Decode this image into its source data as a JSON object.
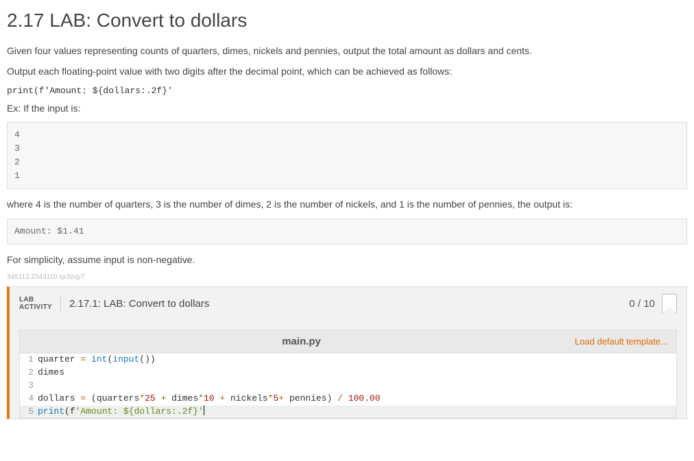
{
  "title": "2.17 LAB: Convert to dollars",
  "intro": "Given four values representing counts of quarters, dimes, nickels and pennies, output the total amount as dollars and cents.",
  "format_note": "Output each floating-point value with two digits after the decimal point, which can be achieved as follows:",
  "format_code": "print(f'Amount: ${dollars:.2f}'",
  "example_label": "Ex: If the input is:",
  "example_input": "4\n3\n2\n1",
  "example_explain": "where 4 is the number of quarters, 3 is the number of dimes, 2 is the number of nickels, and 1 is the number of pennies, the output is:",
  "example_output": "Amount: $1.41",
  "assumption": "For simplicity, assume input is non-negative.",
  "watermark": "345112.2043110.qx3zqy7",
  "lab": {
    "tag_line1": "LAB",
    "tag_line2": "ACTIVITY",
    "activity_title": "2.17.1: LAB: Convert to dollars",
    "score": "0 / 10",
    "filename": "main.py",
    "load_template": "Load default template...",
    "code_lines": [
      {
        "n": "1",
        "raw": "quarter = int(input())"
      },
      {
        "n": "2",
        "raw": "dimes"
      },
      {
        "n": "3",
        "raw": ""
      },
      {
        "n": "4",
        "raw": "dollars = (quarters*25 + dimes*10 + nickels*5+ pennies) / 100.00"
      },
      {
        "n": "5",
        "raw": "print(f'Amount: ${dollars:.2f}'"
      }
    ]
  }
}
